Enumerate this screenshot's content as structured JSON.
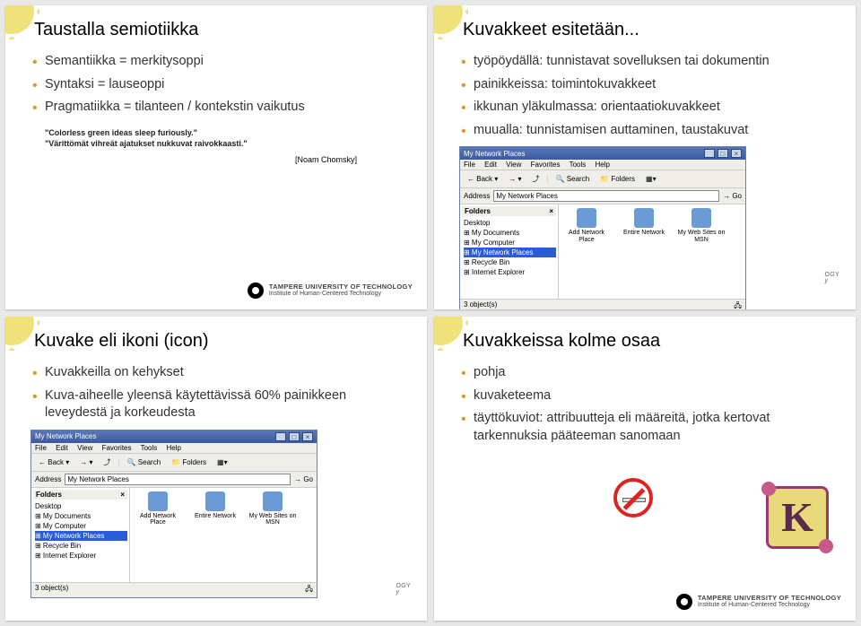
{
  "slide1": {
    "title": "Taustalla semiotiikka",
    "bullets": [
      "Semantiikka = merkitysoppi",
      "Syntaksi = lauseoppi",
      "Pragmatiikka = tilanteen / kontekstin vaikutus"
    ],
    "quote1": "\"Colorless green ideas sleep furiously.\"",
    "quote2": "\"Värittömät vihreät ajatukset nukkuvat raivokkaasti.\"",
    "attribution": "[Noam Chomsky]"
  },
  "slide2": {
    "title": "Kuvakkeet esitetään...",
    "bullets": [
      "työpöydällä: tunnistavat sovelluksen tai dokumentin",
      "painikkeissa: toimintokuvakkeet",
      "ikkunan yläkulmassa: orientaatiokuvakkeet",
      "muualla: tunnistamisen auttaminen, taustakuvat"
    ]
  },
  "slide3": {
    "title": "Kuvake eli ikoni (icon)",
    "bullets": [
      "Kuvakkeilla on kehykset",
      "Kuva-aiheelle yleensä käytettävissä 60% painikkeen leveydestä ja korkeudesta"
    ]
  },
  "slide4": {
    "title": "Kuvakkeissa kolme osaa",
    "bullets": [
      "pohja",
      "kuvaketeema",
      "täyttökuviot: attribuutteja eli määreitä, jotka kertovat tarkennuksia pääteeman sanomaan"
    ]
  },
  "footer": {
    "line1": "TAMPERE UNIVERSITY OF TECHNOLOGY",
    "line2": "Institute of Human-Centered Technology"
  },
  "ology_suffix": "OGY",
  "ology_line2_suffix": "y",
  "window": {
    "title": "My Network Places",
    "menu": [
      "File",
      "Edit",
      "View",
      "Favorites",
      "Tools",
      "Help"
    ],
    "toolbar": {
      "back": "Back",
      "search": "Search",
      "folders": "Folders"
    },
    "address_label": "Address",
    "address_value": "My Network Places",
    "go": "Go",
    "folders_header": "Folders",
    "tree": [
      "Desktop",
      "My Documents",
      "My Computer",
      "My Network Places",
      "Recycle Bin",
      "Internet Explorer"
    ],
    "tree_selected_index": 3,
    "items": [
      "Add Network Place",
      "Entire Network",
      "My Web Sites on MSN"
    ],
    "status_left": "3 object(s)"
  }
}
